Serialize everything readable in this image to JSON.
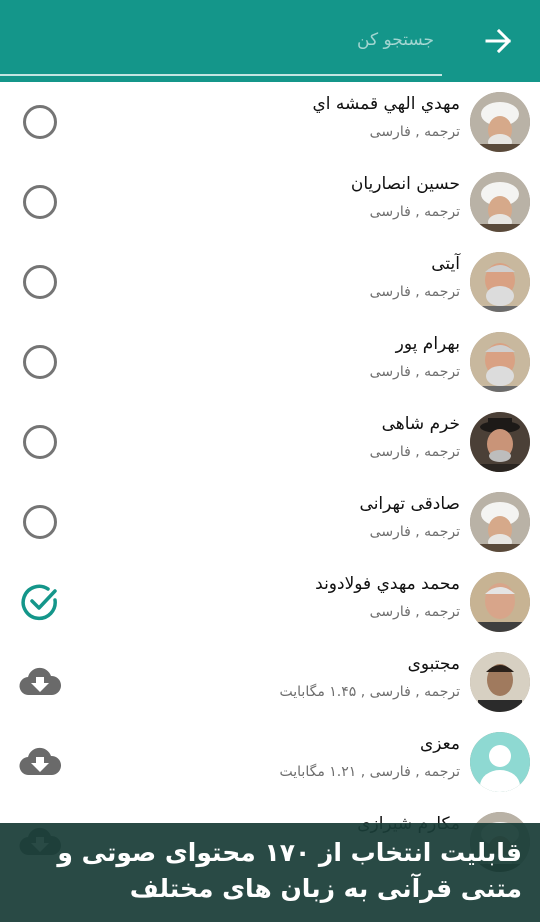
{
  "colors": {
    "accent": "#14968a",
    "check": "#14968a",
    "radio": "#757575",
    "cloud": "#6a6a6a"
  },
  "header": {
    "search_placeholder": "جستجو کن",
    "back_icon": "arrow-right-icon"
  },
  "rows": [
    {
      "name": "مهدي الهي قمشه اي",
      "subtitle": "ترجمه , فارسی",
      "status": "unselected",
      "avatar": "cleric-white-turban"
    },
    {
      "name": "حسين انصاريان",
      "subtitle": "ترجمه , فارسی",
      "status": "unselected",
      "avatar": "cleric-white-turban"
    },
    {
      "name": "آيتی",
      "subtitle": "ترجمه , فارسی",
      "status": "unselected",
      "avatar": "bearded-man"
    },
    {
      "name": "بهرام پور",
      "subtitle": "ترجمه , فارسی",
      "status": "unselected",
      "avatar": "bearded-man"
    },
    {
      "name": "خرم شاهی",
      "subtitle": "ترجمه , فارسی",
      "status": "unselected",
      "avatar": "man-with-hat"
    },
    {
      "name": "صادقی تهرانی",
      "subtitle": "ترجمه , فارسی",
      "status": "unselected",
      "avatar": "cleric-white-turban"
    },
    {
      "name": "محمد مهدي فولادوند",
      "subtitle": "ترجمه , فارسی",
      "status": "selected",
      "avatar": "elderly-man"
    },
    {
      "name": "مجتبوی",
      "subtitle": "ترجمه , فارسی , ۱.۴۵ مگابایت",
      "status": "download",
      "avatar": "man-portrait"
    },
    {
      "name": "معزی",
      "subtitle": "ترجمه , فارسی , ۱.۲۱ مگابایت",
      "status": "download",
      "avatar": "placeholder-person"
    },
    {
      "name": "مکارم شیرازی",
      "subtitle": "",
      "status": "download",
      "avatar": "cleric-white-turban"
    }
  ],
  "banner": {
    "text": "قابلیت انتخاب از ۱۷۰ محتوای صوتی و متنی قرآنی به زبان های مختلف"
  }
}
